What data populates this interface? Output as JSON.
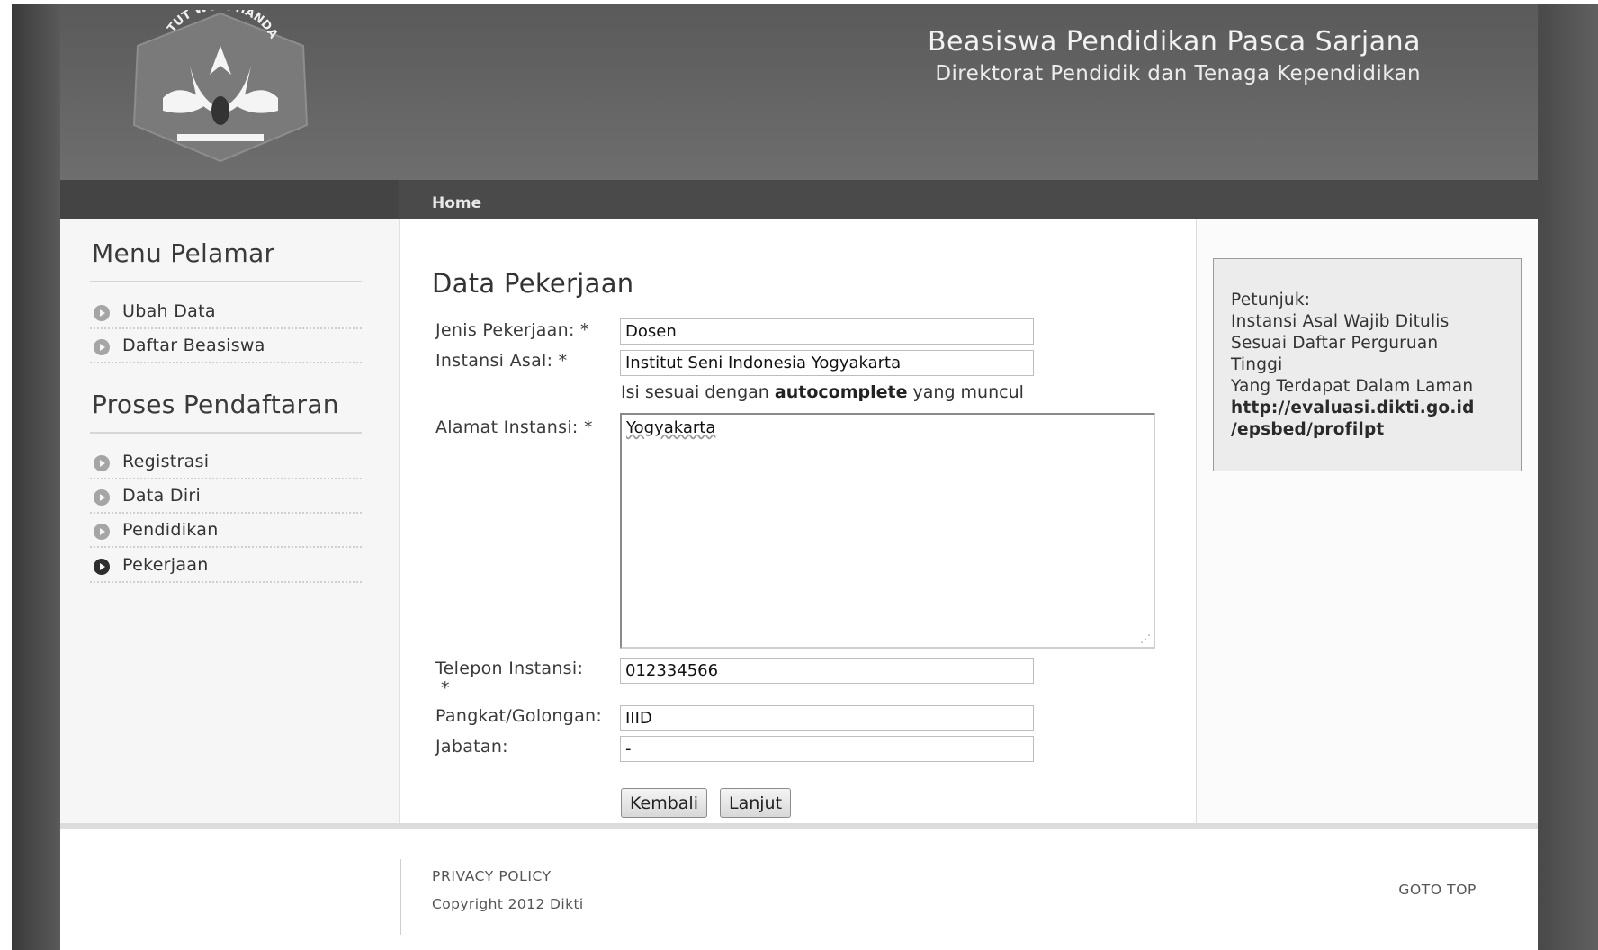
{
  "header": {
    "title": "Beasiswa Pendidikan Pasca Sarjana",
    "subtitle": "Direktorat Pendidik dan Tenaga Kependidikan",
    "logo_text": "TUT WURI HANDAYANI"
  },
  "nav": {
    "home": "Home"
  },
  "sidebar": {
    "menu_heading": "Menu Pelamar",
    "menu_items": [
      {
        "label": "Ubah Data"
      },
      {
        "label": "Daftar Beasiswa"
      }
    ],
    "process_heading": "Proses Pendaftaran",
    "process_items": [
      {
        "label": "Registrasi",
        "active": false
      },
      {
        "label": "Data Diri",
        "active": false
      },
      {
        "label": "Pendidikan",
        "active": false
      },
      {
        "label": "Pekerjaan",
        "active": true
      }
    ]
  },
  "form": {
    "title": "Data Pekerjaan",
    "jenis_label": "Jenis Pekerjaan: *",
    "jenis_value": "Dosen",
    "instansi_label": "Instansi Asal: *",
    "instansi_value": "Institut Seni Indonesia Yogyakarta",
    "hint_pre": "Isi sesuai dengan ",
    "hint_bold": "autocomplete",
    "hint_post": " yang muncul",
    "alamat_label": "Alamat Instansi: *",
    "alamat_value": "Yogyakarta",
    "telepon_label": "Telepon Instansi:",
    "telepon_required": "*",
    "telepon_value": "012334566",
    "pangkat_label": "Pangkat/Golongan:",
    "pangkat_value": "IIID",
    "jabatan_label": "Jabatan:",
    "jabatan_value": "-",
    "back_button": "Kembali",
    "next_button": "Lanjut"
  },
  "hint_box": {
    "title": "Petunjuk:",
    "line1": "Instansi Asal Wajib Ditulis",
    "line2": "Sesuai Daftar Perguruan",
    "line3": "Tinggi",
    "line4": "Yang Terdapat Dalam Laman",
    "url1": "http://evaluasi.dikti.go.id",
    "url2": "/epsbed/profilpt"
  },
  "footer": {
    "privacy": "PRIVACY POLICY",
    "copyright": "Copyright 2012 Dikti",
    "goto_top": "GOTO TOP"
  },
  "colors": {
    "header_bg": "#666666",
    "nav_bg": "#4a4a4a",
    "page_bg": "#fafafa"
  }
}
